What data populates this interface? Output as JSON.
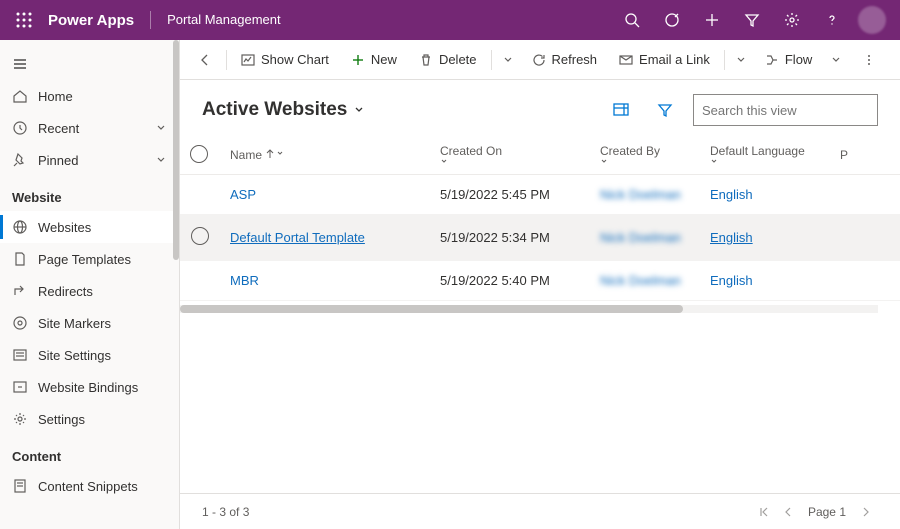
{
  "header": {
    "brand": "Power Apps",
    "area": "Portal Management"
  },
  "sidebar": {
    "items": [
      {
        "label": "Home"
      },
      {
        "label": "Recent"
      },
      {
        "label": "Pinned"
      }
    ],
    "website_header": "Website",
    "website_items": [
      {
        "label": "Websites"
      },
      {
        "label": "Page Templates"
      },
      {
        "label": "Redirects"
      },
      {
        "label": "Site Markers"
      },
      {
        "label": "Site Settings"
      },
      {
        "label": "Website Bindings"
      },
      {
        "label": "Settings"
      }
    ],
    "content_header": "Content",
    "content_items": [
      {
        "label": "Content Snippets"
      }
    ]
  },
  "commands": {
    "show_chart": "Show Chart",
    "new": "New",
    "delete": "Delete",
    "refresh": "Refresh",
    "email_link": "Email a Link",
    "flow": "Flow"
  },
  "view": {
    "title": "Active Websites",
    "search_placeholder": "Search this view"
  },
  "columns": {
    "name": "Name",
    "created_on": "Created On",
    "created_by": "Created By",
    "default_lang": "Default Language",
    "p": "P"
  },
  "rows": [
    {
      "name": "ASP",
      "created_on": "5/19/2022 5:45 PM",
      "created_by": "Nick Doelman",
      "lang": "English",
      "underline": false
    },
    {
      "name": "Default Portal Template",
      "created_on": "5/19/2022 5:34 PM",
      "created_by": "Nick Doelman",
      "lang": "English",
      "underline": true
    },
    {
      "name": "MBR",
      "created_on": "5/19/2022 5:40 PM",
      "created_by": "Nick Doelman",
      "lang": "English",
      "underline": false
    }
  ],
  "footer": {
    "count": "1 - 3 of 3",
    "page": "Page 1"
  }
}
